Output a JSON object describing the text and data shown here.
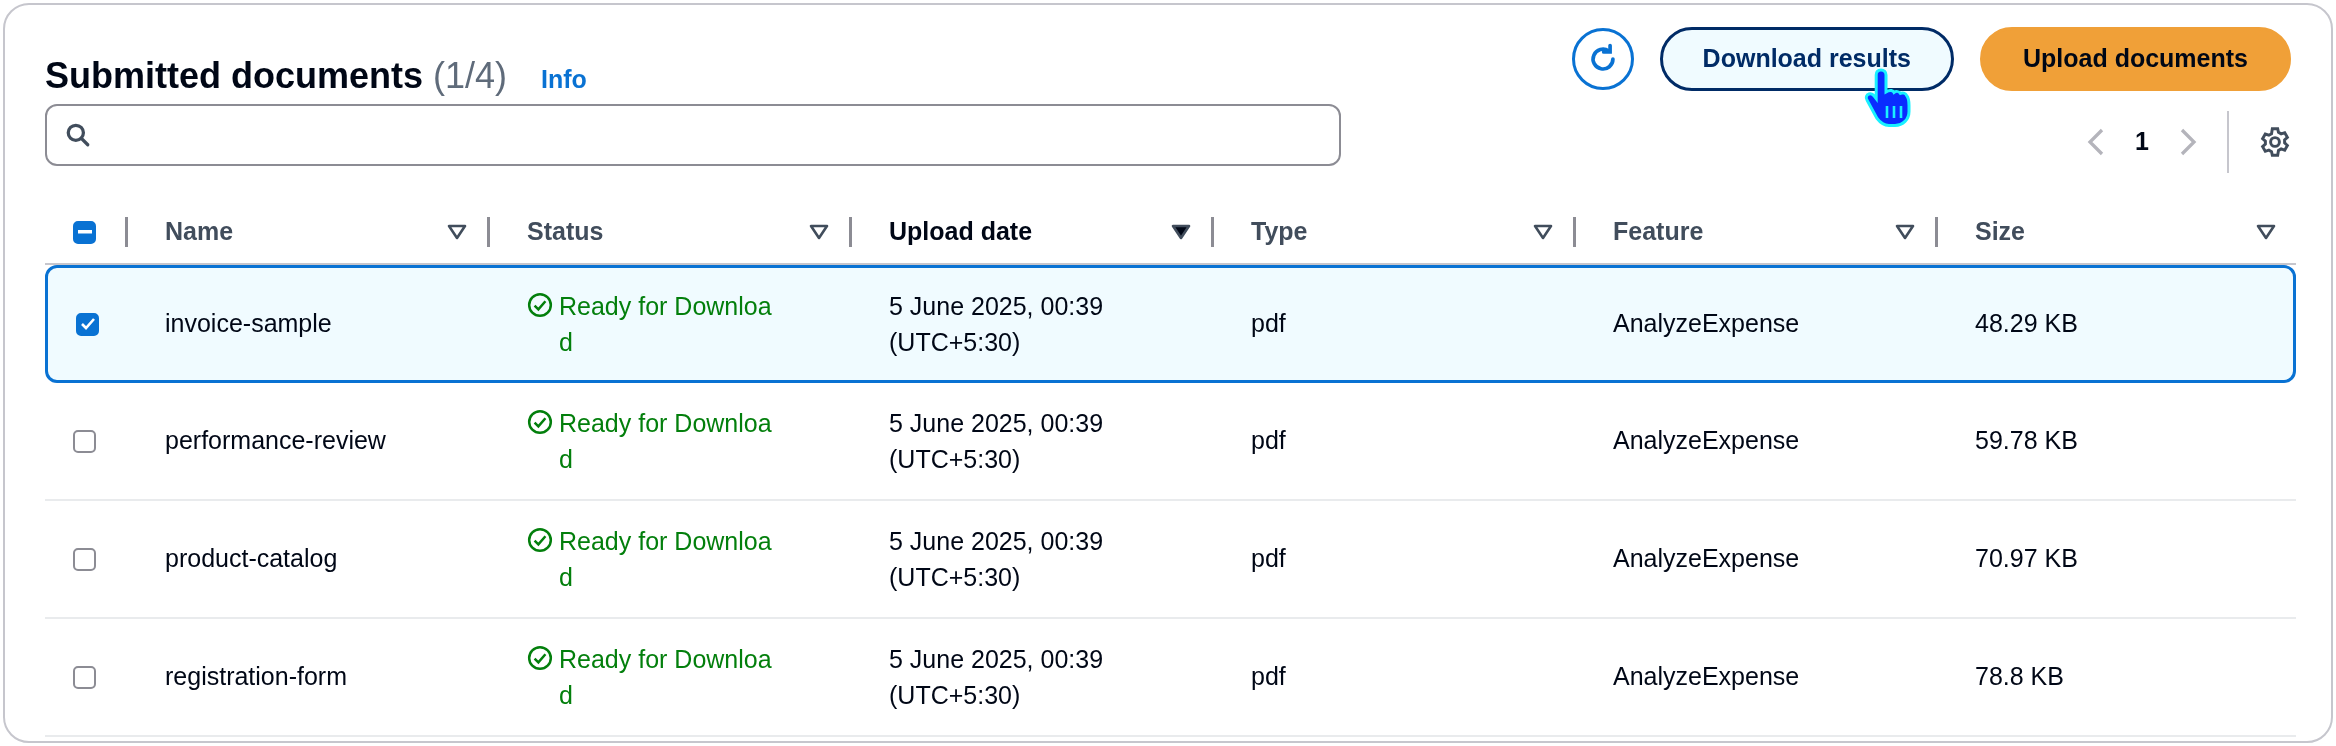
{
  "header": {
    "title": "Submitted documents",
    "count": "(1/4)",
    "info_link": "Info"
  },
  "buttons": [
    {
      "kind": "refresh"
    },
    {
      "kind": "normal",
      "label": "Download results",
      "hovered": true
    },
    {
      "kind": "primary",
      "label": "Upload documents"
    }
  ],
  "pagination": {
    "page": "1",
    "prev_disabled": true,
    "next_disabled": true
  },
  "table": {
    "select_all": {
      "indeterminate": true
    },
    "columns": [
      {
        "label": "Name",
        "sorted": false
      },
      {
        "label": "Status",
        "sorted": false
      },
      {
        "label": "Upload date",
        "sorted": true
      },
      {
        "label": "Type",
        "sorted": false
      },
      {
        "label": "Feature",
        "sorted": false
      },
      {
        "label": "Size",
        "sorted": false
      }
    ],
    "rows": [
      {
        "selected": true,
        "name": "invoice-sample",
        "status": "Ready for Download",
        "upload_date": "5 June 2025, 00:39",
        "timezone": "(UTC+5:30)",
        "type": "pdf",
        "feature": "AnalyzeExpense",
        "size": "48.29 KB"
      },
      {
        "selected": false,
        "name": "performance-review",
        "status": "Ready for Download",
        "upload_date": "5 June 2025, 00:39",
        "timezone": "(UTC+5:30)",
        "type": "pdf",
        "feature": "AnalyzeExpense",
        "size": "59.78 KB"
      },
      {
        "selected": false,
        "name": "product-catalog",
        "status": "Ready for Download",
        "upload_date": "5 June 2025, 00:39",
        "timezone": "(UTC+5:30)",
        "type": "pdf",
        "feature": "AnalyzeExpense",
        "size": "70.97 KB"
      },
      {
        "selected": false,
        "name": "registration-form",
        "status": "Ready for Download",
        "upload_date": "5 June 2025, 00:39",
        "timezone": "(UTC+5:30)",
        "type": "pdf",
        "feature": "AnalyzeExpense",
        "size": "78.8 KB"
      }
    ]
  }
}
